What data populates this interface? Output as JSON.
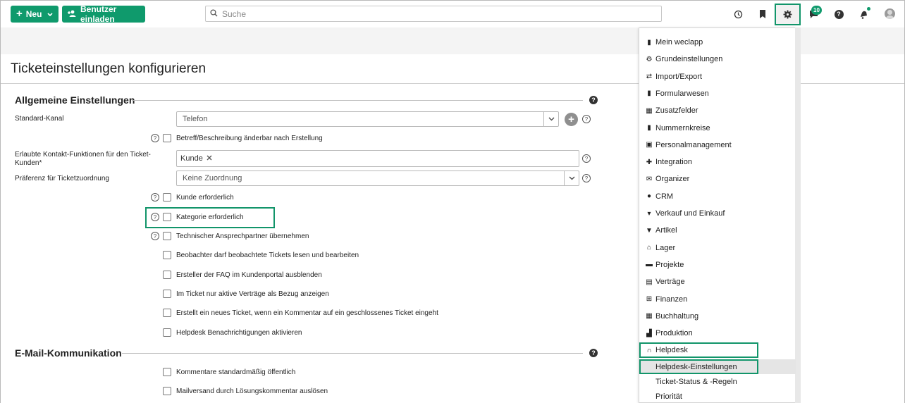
{
  "topbar": {
    "new_label": "Neu",
    "invite_label": "Benutzer einladen",
    "search_placeholder": "Suche",
    "chat_badge": "10"
  },
  "page": {
    "title": "Ticketeinstellungen konfigurieren"
  },
  "general": {
    "heading": "Allgemeine Einstellungen",
    "standard_channel_label": "Standard-Kanal",
    "standard_channel_value": "Telefon",
    "allowed_contact_label": "Erlaubte Kontakt-Funktionen für den Ticket-Kunden*",
    "allowed_contact_tag": "Kunde",
    "preference_label": "Präferenz für Ticketzuordnung",
    "preference_value": "Keine Zuordnung",
    "checkboxes": [
      "Betreff/Beschreibung änderbar nach Erstellung",
      "Kunde erforderlich",
      "Kategorie erforderlich",
      "Technischer Ansprechpartner übernehmen",
      "Beobachter darf beobachtete Tickets lesen und bearbeiten",
      "Ersteller der FAQ im Kundenportal ausblenden",
      "Im Ticket nur aktive Verträge als Bezug anzeigen",
      "Erstellt ein neues Ticket, wenn ein Kommentar auf ein geschlossenes Ticket eingeht",
      "Helpdesk Benachrichtigungen aktivieren"
    ]
  },
  "email": {
    "heading": "E-Mail-Kommunikation",
    "checkboxes": [
      "Kommentare standardmäßig öffentlich",
      "Mailversand durch Lösungskommentar auslösen"
    ]
  },
  "menu": {
    "items": [
      {
        "label": "Mein weclapp",
        "icon": "chart-icon"
      },
      {
        "label": "Grundeinstellungen",
        "icon": "gear-icon"
      },
      {
        "label": "Import/Export",
        "icon": "swap-icon"
      },
      {
        "label": "Formularwesen",
        "icon": "document-icon"
      },
      {
        "label": "Zusatzfelder",
        "icon": "grid-icon"
      },
      {
        "label": "Nummernkreise",
        "icon": "bars-icon"
      },
      {
        "label": "Personalmanagement",
        "icon": "badge-icon"
      },
      {
        "label": "Integration",
        "icon": "puzzle-icon"
      },
      {
        "label": "Organizer",
        "icon": "mail-icon"
      },
      {
        "label": "CRM",
        "icon": "people-icon"
      },
      {
        "label": "Verkauf und Einkauf",
        "icon": "cart-icon"
      },
      {
        "label": "Artikel",
        "icon": "box-icon"
      },
      {
        "label": "Lager",
        "icon": "warehouse-icon"
      },
      {
        "label": "Projekte",
        "icon": "briefcase-icon"
      },
      {
        "label": "Verträge",
        "icon": "contract-icon"
      },
      {
        "label": "Finanzen",
        "icon": "bank-icon"
      },
      {
        "label": "Buchhaltung",
        "icon": "calculator-icon"
      },
      {
        "label": "Produktion",
        "icon": "factory-icon"
      },
      {
        "label": "Helpdesk",
        "icon": "headset-icon"
      }
    ],
    "sub_items": [
      "Helpdesk-Einstellungen",
      "Ticket-Status & -Regeln",
      "Priorität"
    ]
  },
  "colors": {
    "accent_green": "#0f9a6c",
    "highlight_border": "#12956a"
  }
}
